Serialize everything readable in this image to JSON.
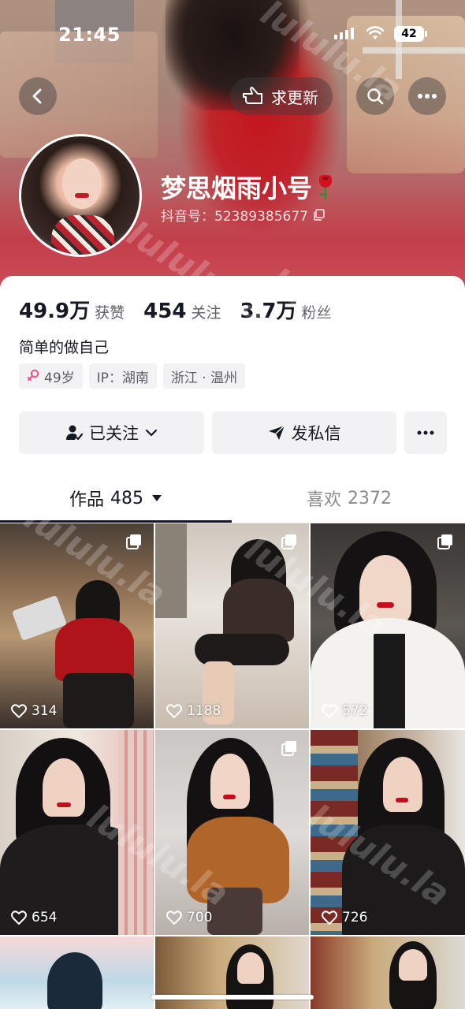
{
  "status_bar": {
    "time": "21:45",
    "battery": "42"
  },
  "header": {
    "update_button": "求更新",
    "nickname": "梦思烟雨小号",
    "douyin_id": "抖音号：52389385677"
  },
  "stats": [
    {
      "value": "49.9万",
      "label": "获赞"
    },
    {
      "value": "454",
      "label": "关注"
    },
    {
      "value": "3.7万",
      "label": "粉丝"
    }
  ],
  "bio": "简单的做自己",
  "tags": {
    "age": "49岁",
    "ip": "IP：湖南",
    "location": "浙江 · 温州"
  },
  "actions": {
    "follow": "已关注",
    "message": "发私信"
  },
  "tabs": {
    "works_label": "作品",
    "works_count": "485",
    "likes_label": "喜欢",
    "likes_count": "2372"
  },
  "videos": [
    {
      "likes": "314"
    },
    {
      "likes": "1188"
    },
    {
      "likes": "572"
    },
    {
      "likes": "654"
    },
    {
      "likes": "700"
    },
    {
      "likes": "726"
    }
  ],
  "watermark": "lululu.la",
  "icons": [
    "back-icon",
    "hand-pointer-icon",
    "search-icon",
    "more-icon",
    "copy-icon",
    "female-icon",
    "person-check-icon",
    "chevron-down-icon",
    "send-icon",
    "caret-down-icon",
    "heart-icon",
    "multi-image-icon",
    "rose-emoji"
  ],
  "colors": {
    "accent_red": "#c4151e",
    "text": "#161823",
    "muted": "#5c5d66",
    "chip_bg": "#f2f2f4",
    "female_pink": "#f3518b"
  }
}
